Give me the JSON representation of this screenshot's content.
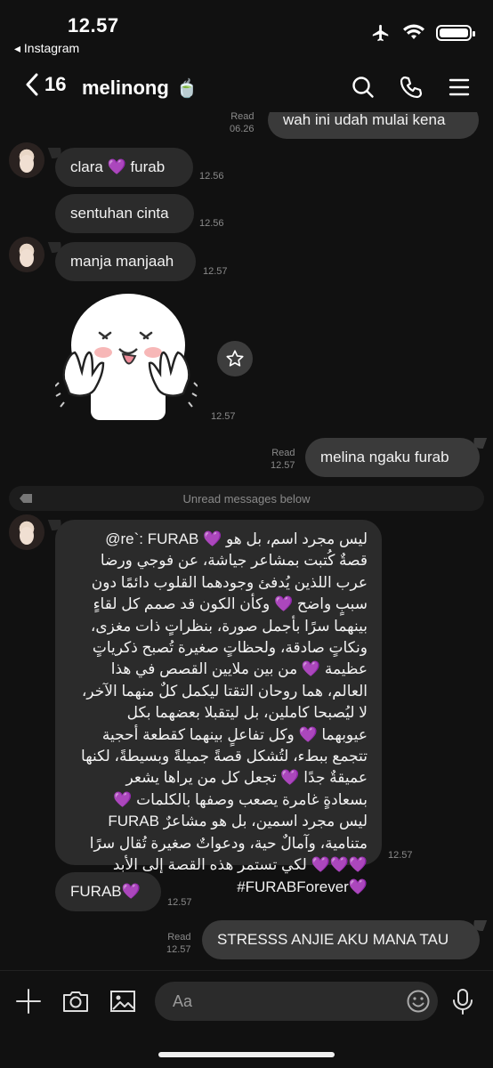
{
  "status_bar": {
    "time": "12.57",
    "back_app": "◂ Instagram"
  },
  "header": {
    "back_count": "16",
    "title": "melinong",
    "title_emoji": "🍵"
  },
  "messages": {
    "m1": {
      "text": "wah ini udah mulai kena",
      "read": "Read",
      "time": "06.26"
    },
    "m2": {
      "text": "clara 💜 furab",
      "time": "12.56"
    },
    "m3": {
      "text": "sentuhan cinta",
      "time": "12.56"
    },
    "m4": {
      "text": "manja manjaah",
      "time": "12.57"
    },
    "sticker": {
      "time": "12.57"
    },
    "m5": {
      "text": "melina ngaku furab",
      "read": "Read",
      "time": "12.57"
    },
    "unread_divider": "Unread messages below",
    "m6": {
      "text": "@re`: FURAB 💜 ليس مجرد اسم، بل هو\nقصةٌ كُتبت بمشاعر جياشة، عن فوجي ورضا\nعرب اللذين يُدفئ وجودهما القلوب دائمًا دون\nسببٍ واضح 💜 وكأن الكون قد صمم كل لقاءٍ\nبينهما سرًا بأجمل صورة، بنظراتٍ ذات مغزى،\nونكاتٍ صادقة، ولحظاتٍ صغيرة تُصبح ذكرياتٍ\nعظيمة 💜 من بين ملايين القصص في هذا\nالعالم، هما روحان التقتا ليكمل كلٌ منهما الآخر،\nلا ليُصبحا كاملين، بل ليتقبلا بعضهما بكل\nعيوبهما 💜 وكل تفاعلٍ بينهما كقطعة أحجية\nتتجمع ببطء، لتُشكل قصةً جميلةً وبسيطةً، لكنها\nعميقةٌ جدًا 💜 تجعل كل من يراها يشعر\nبسعادةٍ غامرة يصعب وصفها بالكلمات 💜\nFURAB ليس مجرد اسمين، بل هو مشاعرٌ\nمتنامية، وآمالٌ حية، ودعواتٌ صغيرة تُقال سرًا\n💜💜💜 لكي تستمر هذه القصة إلى الأبد\n#FURABForever💜",
      "time": "12.57"
    },
    "m7": {
      "text": "FURAB💜",
      "time": "12.57"
    },
    "m8": {
      "text": "STRESSS ANJIE AKU MANA TAU",
      "read": "Read",
      "time": "12.57"
    }
  },
  "input": {
    "placeholder": "Aa"
  },
  "icons": [
    "back-chevron-icon",
    "search-icon",
    "phone-icon",
    "menu-icon",
    "star-icon",
    "plus-icon",
    "camera-icon",
    "image-icon",
    "emoji-icon",
    "microphone-icon"
  ]
}
